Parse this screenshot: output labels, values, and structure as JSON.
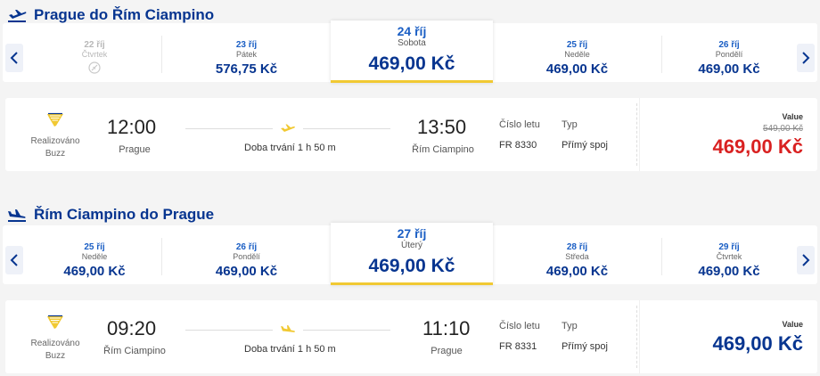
{
  "outbound": {
    "title": "Prague do Řím Ciampino",
    "days": [
      {
        "date": "22 říj",
        "day": "Čtvrtek",
        "price": ""
      },
      {
        "date": "23 říj",
        "day": "Pátek",
        "price": "576,75 Kč"
      },
      {
        "date": "24 říj",
        "day": "Sobota",
        "price": "469,00 Kč"
      },
      {
        "date": "25 říj",
        "day": "Neděle",
        "price": "469,00 Kč"
      },
      {
        "date": "26 říj",
        "day": "Pondělí",
        "price": "469,00 Kč"
      }
    ],
    "flight": {
      "operated_by": "Realizováno Buzz",
      "dep_time": "12:00",
      "dep_city": "Prague",
      "duration": "Doba trvání 1 h 50 m",
      "arr_time": "13:50",
      "arr_city": "Řím Ciampino",
      "flight_no_label": "Číslo letu",
      "flight_no": "FR 8330",
      "type_label": "Typ",
      "type": "Přímý spoj",
      "value_label": "Value",
      "old_price": "549,00 Kč",
      "price": "469,00 Kč",
      "price_color": "#d92121"
    }
  },
  "inbound": {
    "title": "Řím Ciampino do Prague",
    "days": [
      {
        "date": "25 říj",
        "day": "Neděle",
        "price": "469,00 Kč"
      },
      {
        "date": "26 říj",
        "day": "Pondělí",
        "price": "469,00 Kč"
      },
      {
        "date": "27 říj",
        "day": "Úterý",
        "price": "469,00 Kč"
      },
      {
        "date": "28 říj",
        "day": "Středa",
        "price": "469,00 Kč"
      },
      {
        "date": "29 říj",
        "day": "Čtvrtek",
        "price": "469,00 Kč"
      }
    ],
    "flight": {
      "operated_by": "Realizováno Buzz",
      "dep_time": "09:20",
      "dep_city": "Řím Ciampino",
      "duration": "Doba trvání 1 h 50 m",
      "arr_time": "11:10",
      "arr_city": "Prague",
      "flight_no_label": "Číslo letu",
      "flight_no": "FR 8331",
      "type_label": "Typ",
      "type": "Přímý spoj",
      "value_label": "Value",
      "price": "469,00 Kč",
      "price_color": "#073590"
    }
  },
  "icons": {
    "takeoff": "takeoff-plane-icon",
    "landing": "landing-plane-icon",
    "airline_logo": "ryanair-harp-icon",
    "unavailable": "unavailable-icon",
    "chevron_left": "chevron-left-icon",
    "chevron_right": "chevron-right-icon"
  },
  "colors": {
    "brand_blue": "#073590",
    "accent_yellow": "#f1c933",
    "sale_red": "#d92121"
  }
}
